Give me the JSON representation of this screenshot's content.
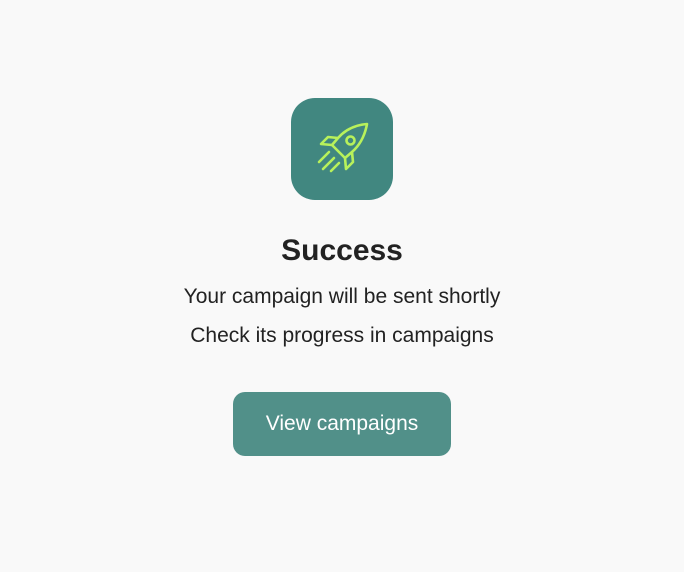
{
  "success_panel": {
    "icon": "rocket-icon",
    "title": "Success",
    "message_line_1": "Your campaign will be sent shortly",
    "message_line_2": "Check its progress in campaigns",
    "button_label": "View campaigns"
  },
  "colors": {
    "page_background": "#f9f9f9",
    "icon_tile": "#418780",
    "icon_stroke": "#b8f15b",
    "button_background": "#519089",
    "button_text": "#ffffff",
    "text": "#222222"
  }
}
